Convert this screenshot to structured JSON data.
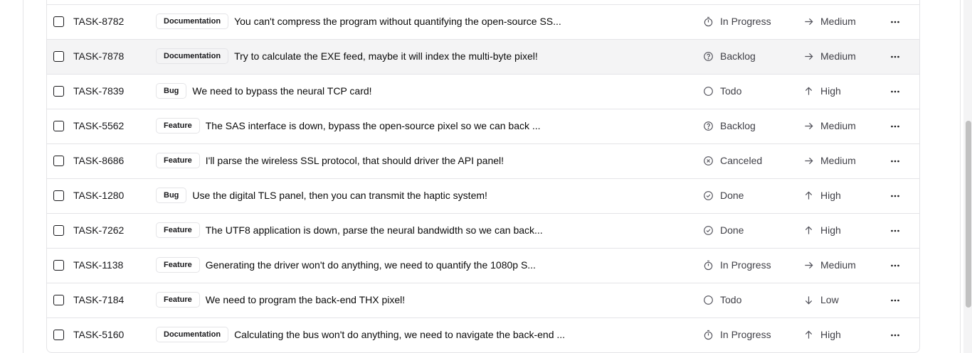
{
  "rows": [
    {
      "id": "TASK-8782",
      "label": "Documentation",
      "title": "You can't compress the program without quantifying the open-source SS...",
      "status": "In Progress",
      "status_icon": "timer-icon",
      "priority": "Medium",
      "priority_icon": "arrow-right-icon"
    },
    {
      "id": "TASK-7878",
      "label": "Documentation",
      "title": "Try to calculate the EXE feed, maybe it will index the multi-byte pixel!",
      "status": "Backlog",
      "status_icon": "help-circle-icon",
      "priority": "Medium",
      "priority_icon": "arrow-right-icon"
    },
    {
      "id": "TASK-7839",
      "label": "Bug",
      "title": "We need to bypass the neural TCP card!",
      "status": "Todo",
      "status_icon": "circle-icon",
      "priority": "High",
      "priority_icon": "arrow-up-icon"
    },
    {
      "id": "TASK-5562",
      "label": "Feature",
      "title": "The SAS interface is down, bypass the open-source pixel so we can back ...",
      "status": "Backlog",
      "status_icon": "help-circle-icon",
      "priority": "Medium",
      "priority_icon": "arrow-right-icon"
    },
    {
      "id": "TASK-8686",
      "label": "Feature",
      "title": "I'll parse the wireless SSL protocol, that should driver the API panel!",
      "status": "Canceled",
      "status_icon": "x-circle-icon",
      "priority": "Medium",
      "priority_icon": "arrow-right-icon"
    },
    {
      "id": "TASK-1280",
      "label": "Bug",
      "title": "Use the digital TLS panel, then you can transmit the haptic system!",
      "status": "Done",
      "status_icon": "check-circle-icon",
      "priority": "High",
      "priority_icon": "arrow-up-icon"
    },
    {
      "id": "TASK-7262",
      "label": "Feature",
      "title": "The UTF8 application is down, parse the neural bandwidth so we can back...",
      "status": "Done",
      "status_icon": "check-circle-icon",
      "priority": "High",
      "priority_icon": "arrow-up-icon"
    },
    {
      "id": "TASK-1138",
      "label": "Feature",
      "title": "Generating the driver won't do anything, we need to quantify the 1080p S...",
      "status": "In Progress",
      "status_icon": "timer-icon",
      "priority": "Medium",
      "priority_icon": "arrow-right-icon"
    },
    {
      "id": "TASK-7184",
      "label": "Feature",
      "title": "We need to program the back-end THX pixel!",
      "status": "Todo",
      "status_icon": "circle-icon",
      "priority": "Low",
      "priority_icon": "arrow-down-icon"
    },
    {
      "id": "TASK-5160",
      "label": "Documentation",
      "title": "Calculating the bus won't do anything, we need to navigate the back-end ...",
      "status": "In Progress",
      "status_icon": "timer-icon",
      "priority": "High",
      "priority_icon": "arrow-up-icon"
    }
  ],
  "highlighted_row": 1
}
